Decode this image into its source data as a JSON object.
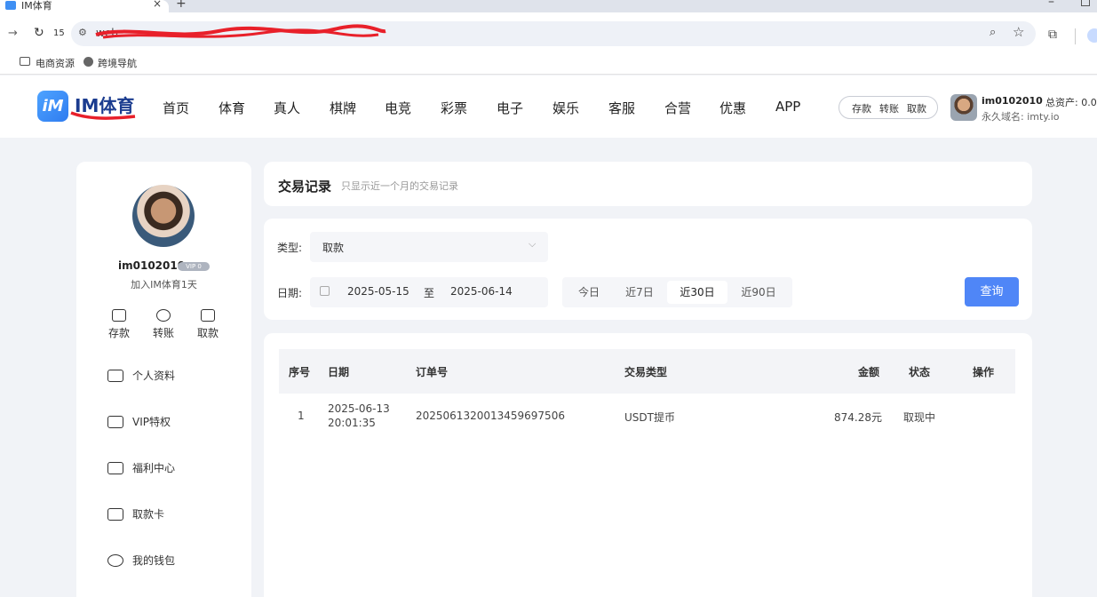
{
  "browser": {
    "tab_title": "IM体育",
    "tab_close": "×",
    "new_tab": "+",
    "reload_count": "15",
    "url_text": "web",
    "forward_icon": "arrow-right-icon",
    "reload_icon": "reload-icon"
  },
  "bookmarks": [
    {
      "label": "电商资源",
      "icon": "folder-icon"
    },
    {
      "label": "跨境导航",
      "icon": "globe-icon"
    }
  ],
  "header": {
    "logo_mark": "iM",
    "logo_text": "IM体育",
    "nav": [
      "首页",
      "体育",
      "真人",
      "棋牌",
      "电竞",
      "彩票",
      "电子",
      "娱乐",
      "客服",
      "合营",
      "优惠",
      "APP"
    ],
    "quick_actions": [
      "存款",
      "转账",
      "取款"
    ],
    "username": "im0102010",
    "assets_label": "总资产: 0.0",
    "domain_label": "永久域名: imty.io"
  },
  "sidebar": {
    "username": "im0102010",
    "vip_badge": "VIP 0",
    "joined": "加入IM体育1天",
    "actions": [
      {
        "label": "存款",
        "icon": "wallet-icon"
      },
      {
        "label": "转账",
        "icon": "transfer-icon"
      },
      {
        "label": "取款",
        "icon": "withdraw-icon"
      }
    ],
    "menu": [
      {
        "label": "个人资料",
        "icon": "id-card-icon"
      },
      {
        "label": "VIP特权",
        "icon": "crown-icon"
      },
      {
        "label": "福利中心",
        "icon": "gift-icon"
      },
      {
        "label": "取款卡",
        "icon": "card-icon"
      },
      {
        "label": "我的钱包",
        "icon": "wallet-icon"
      }
    ]
  },
  "page": {
    "title": "交易记录",
    "subtitle": "只显示近一个月的交易记录"
  },
  "filters": {
    "type_label": "类型:",
    "type_value": "取款",
    "date_label": "日期:",
    "date_from": "2025-05-15",
    "date_sep": "至",
    "date_to": "2025-06-14",
    "quick_dates": [
      "今日",
      "近7日",
      "近30日",
      "近90日"
    ],
    "quick_active": "近30日",
    "query_button": "查询"
  },
  "table": {
    "headers": [
      "序号",
      "日期",
      "订单号",
      "交易类型",
      "金额",
      "状态",
      "操作"
    ],
    "rows": [
      {
        "index": "1",
        "date": "2025-06-13",
        "time": "20:01:35",
        "order_no": "20250613200134596975 06",
        "order_no_full": "2025061320013459697506",
        "type": "USDT提币",
        "amount": "874.28元",
        "status": "取现中",
        "action": ""
      }
    ]
  },
  "colors": {
    "accent": "#4f86f7",
    "brand": "#2f7cf0",
    "page_bg": "#f1f3f7",
    "scribble": "#e8202a"
  }
}
